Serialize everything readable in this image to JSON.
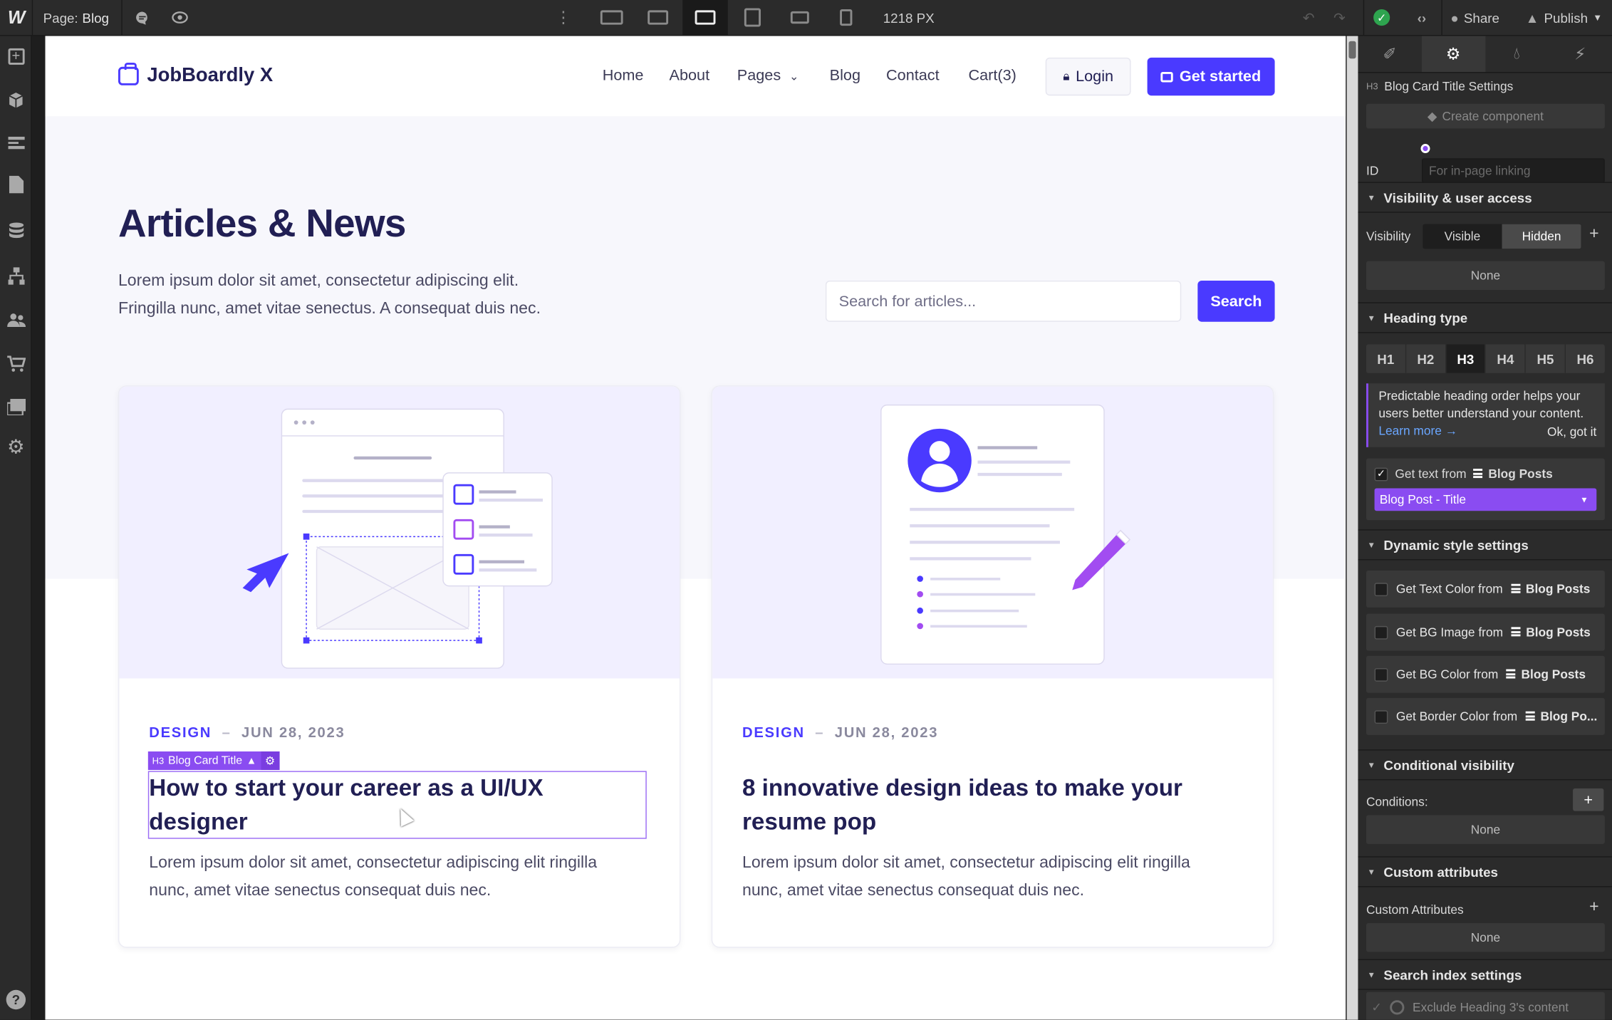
{
  "topbar": {
    "logo": "W",
    "page_label": "Page:",
    "page_name": "Blog",
    "width_readout": "1218 PX",
    "share": "Share",
    "publish": "Publish"
  },
  "site": {
    "brand": "JobBoardly X",
    "nav": [
      "Home",
      "About",
      "Pages",
      "Blog",
      "Contact",
      "Cart(3)"
    ],
    "login": "Login",
    "get_started": "Get started",
    "hero_title": "Articles & News",
    "hero_lead_1": "Lorem ipsum dolor sit amet, consectetur adipiscing elit.",
    "hero_lead_2": "Fringilla nunc, amet vitae senectus. A consequat duis nec.",
    "search_placeholder": "Search for articles...",
    "search_button": "Search",
    "cards": [
      {
        "category": "DESIGN",
        "date": "JUN 28, 2023",
        "title": "How to start your career as a UI/UX designer",
        "excerpt": "Lorem ipsum dolor sit amet, consectetur adipiscing elit ringilla nunc, amet vitae senectus consequat duis nec."
      },
      {
        "category": "DESIGN",
        "date": "JUN 28, 2023",
        "title": "8 innovative design ideas to make your resume pop",
        "excerpt": "Lorem ipsum dolor sit amet, consectetur adipiscing elit ringilla nunc, amet vitae senectus consequat duis nec."
      }
    ],
    "selection_tag_type": "H3",
    "selection_tag_label": "Blog Card Title"
  },
  "panel": {
    "element_tag": "H3",
    "element_title": "Blog Card Title Settings",
    "create_component": "Create component",
    "id_label": "ID",
    "id_placeholder": "For in-page linking",
    "visibility_section": "Visibility & user access",
    "visibility_label": "Visibility",
    "visible": "Visible",
    "hidden": "Hidden",
    "none": "None",
    "heading_type_section": "Heading type",
    "headings": [
      "H1",
      "H2",
      "H3",
      "H4",
      "H5",
      "H6"
    ],
    "selected_heading": "H3",
    "tip_text": "Predictable heading order helps your users better understand your content.",
    "learn_more": "Learn more →",
    "ok_got_it": "Ok, got it",
    "get_text_from": "Get text from",
    "collection": "Blog Posts",
    "bound_field": "Blog Post - Title",
    "dynamic_style_section": "Dynamic style settings",
    "dynamic_rows": [
      {
        "label": "Get Text Color from",
        "source": "Blog Posts"
      },
      {
        "label": "Get BG Image from",
        "source": "Blog Posts"
      },
      {
        "label": "Get BG Color from",
        "source": "Blog Posts"
      },
      {
        "label": "Get Border Color from",
        "source": "Blog Po..."
      }
    ],
    "conditional_section": "Conditional visibility",
    "conditions_label": "Conditions:",
    "custom_attr_section": "Custom attributes",
    "custom_attr_label": "Custom Attributes",
    "search_index_section": "Search index settings",
    "exclude_text": "Exclude Heading 3's content"
  },
  "colors": {
    "brand": "#4a3aff",
    "selection": "#8a4cf1",
    "panel_bg": "#2b2b2b"
  }
}
